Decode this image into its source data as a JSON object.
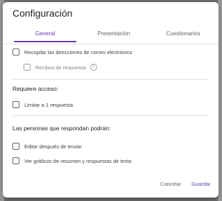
{
  "dialog": {
    "title": "Configuración",
    "tabs": [
      {
        "label": "General",
        "active": true
      },
      {
        "label": "Presentación",
        "active": false
      },
      {
        "label": "Cuestionarios",
        "active": false
      }
    ],
    "options": {
      "collect_emails": {
        "label": "Recopilar las direcciones de correo electrónico",
        "checked": false
      },
      "response_receipts": {
        "label": "Recibos de respuesta",
        "checked": false,
        "enabled": false,
        "help_icon": "question-circle-icon"
      }
    },
    "requires_access": {
      "title": "Requiere acceso:",
      "limit_one": {
        "label": "Limitar a 1 respuesta",
        "checked": false
      }
    },
    "respondents": {
      "title": "Las personas que respondan podrán:",
      "edit_after": {
        "label": "Editar después de enviar",
        "checked": false
      },
      "see_charts": {
        "label": "Ver gráficos de resumen y respuestas de texto",
        "checked": false
      }
    },
    "actions": {
      "cancel": "Cancelar",
      "save": "Guardar"
    }
  },
  "colors": {
    "accent": "#673ab7",
    "text": "#202124",
    "muted": "#5f6368",
    "divider": "#e0e0e0",
    "backdrop": "#6e6e6e"
  }
}
